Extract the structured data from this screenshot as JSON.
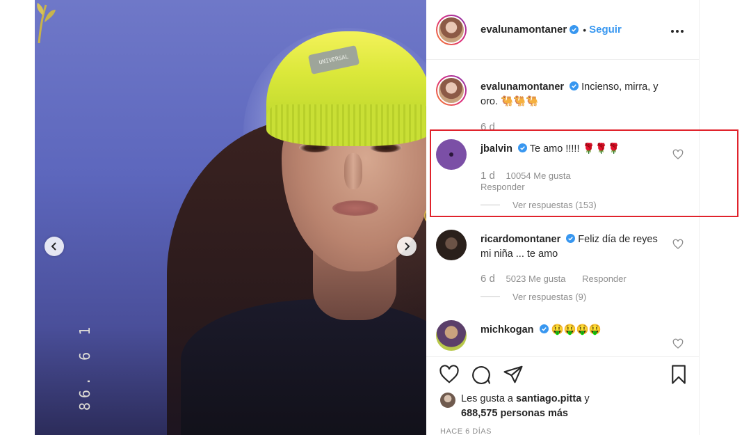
{
  "photo": {
    "date_stamp": "86. 6 1",
    "beanie_label": "UNIVERSAL"
  },
  "header": {
    "username": "evalunamontaner",
    "separator": "•",
    "follow_label": "Seguir"
  },
  "caption": {
    "username": "evalunamontaner",
    "text": "Incienso, mirra, y oro. 🐫🐫🐫",
    "time": "6 d"
  },
  "comments": [
    {
      "username": "jbalvin",
      "text": "Te amo !!!!! 🌹🌹🌹",
      "time": "1 d",
      "likes": "10054 Me gusta",
      "reply_label": "Responder",
      "view_replies": "Ver respuestas (153)"
    },
    {
      "username": "ricardomontaner",
      "text": "Feliz día de reyes mi niña ... te amo",
      "time": "6 d",
      "likes": "5023 Me gusta",
      "reply_label": "Responder",
      "view_replies": "Ver respuestas (9)"
    },
    {
      "username": "michkogan",
      "text": "🤑🤑🤑🤑"
    }
  ],
  "actions": {
    "liked_by_prefix": "Les gusta a",
    "liked_by_user": "santiago.pitta",
    "liked_by_suffix": "y",
    "others": "688,575 personas más",
    "date": "HACE 6 DÍAS"
  },
  "colors": {
    "link_blue": "#3897f0",
    "highlight_red": "#e0232c",
    "muted_text": "#8e8e8e"
  },
  "icons": [
    "chevron-left-icon",
    "chevron-right-icon",
    "verified-icon",
    "more-icon",
    "heart-icon",
    "comment-icon",
    "share-icon",
    "bookmark-icon"
  ]
}
